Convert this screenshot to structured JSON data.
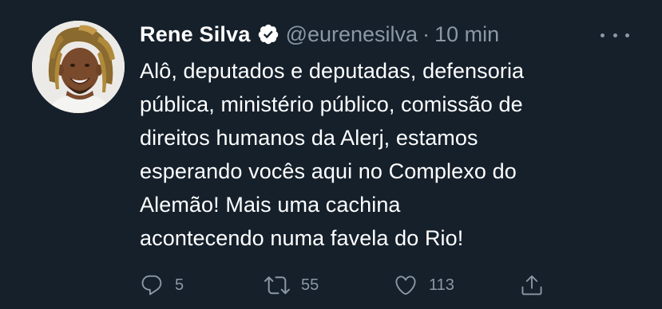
{
  "tweet": {
    "author": {
      "name": "Rene Silva",
      "handle": "@eurenesilva",
      "verified": true
    },
    "separator": "·",
    "time": "10 min",
    "text_lines": [
      "Alô, deputados e deputadas, defensoria",
      "pública, ministério público, comissão de",
      "direitos humanos da Alerj, estamos",
      "esperando vocês aqui no Complexo do",
      "Alemão! Mais uma cachina",
      "acontecendo numa favela do Rio!"
    ],
    "stats": {
      "replies": "5",
      "retweets": "55",
      "likes": "113"
    }
  },
  "icons": {
    "verified": "verified-badge-icon",
    "more": "more-dots-icon",
    "reply": "reply-icon",
    "retweet": "retweet-icon",
    "like": "heart-icon",
    "share": "share-icon"
  },
  "colors": {
    "background": "#15202b",
    "text": "#ffffff",
    "secondary": "#8b98a5"
  }
}
